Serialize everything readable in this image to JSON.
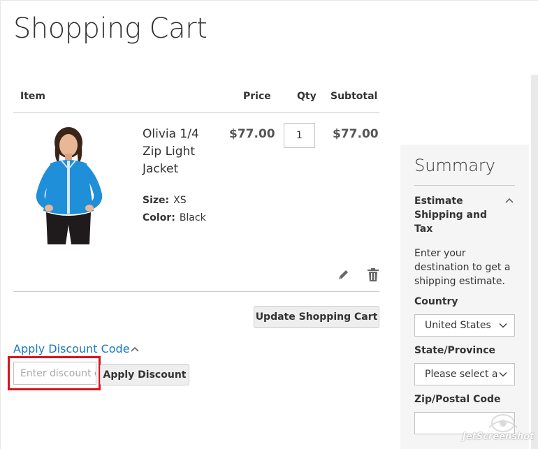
{
  "page": {
    "title": "Shopping Cart"
  },
  "cart": {
    "headers": {
      "item": "Item",
      "price": "Price",
      "qty": "Qty",
      "subtotal": "Subtotal"
    },
    "item": {
      "name": "Olivia 1/4 Zip Light Jacket",
      "options": [
        {
          "label": "Size:",
          "value": "XS"
        },
        {
          "label": "Color:",
          "value": "Black"
        }
      ],
      "price": "$77.00",
      "qty": "1",
      "subtotal": "$77.00",
      "image_icon": "jacket-product-photo"
    },
    "actions": {
      "edit_icon": "pencil-icon",
      "delete_icon": "trash-icon"
    },
    "update_label": "Update Shopping Cart"
  },
  "discount": {
    "title": "Apply Discount Code",
    "placeholder": "Enter discount code",
    "apply_label": "Apply Discount"
  },
  "summary": {
    "title": "Summary",
    "estimate_title": "Estimate Shipping and Tax",
    "estimate_desc": "Enter your destination to get a shipping estimate.",
    "country_label": "Country",
    "country_value": "United States",
    "state_label": "State/Province",
    "state_value": "Please select a region, state or province.",
    "zip_label": "Zip/Postal Code",
    "zip_value": ""
  },
  "watermark": {
    "text": "JetScreenshot"
  },
  "colors": {
    "link": "#1979c3",
    "highlight": "#d9141d",
    "summary_bg": "#f5f5f5",
    "button_bg": "#eeeeee"
  }
}
